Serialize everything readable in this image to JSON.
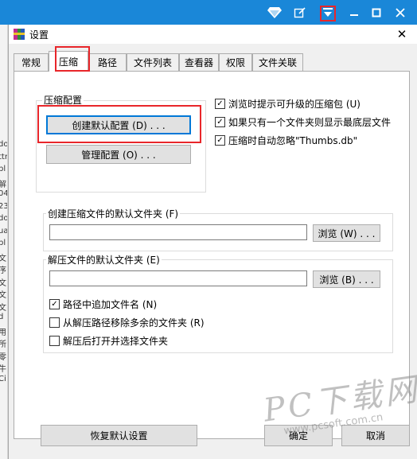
{
  "dialog": {
    "title": "设置",
    "close_glyph": "✕"
  },
  "tabs": [
    {
      "label": "常规",
      "active": false
    },
    {
      "label": "压缩",
      "active": true
    },
    {
      "label": "路径",
      "active": false
    },
    {
      "label": "文件列表",
      "active": false
    },
    {
      "label": "查看器",
      "active": false
    },
    {
      "label": "权限",
      "active": false
    },
    {
      "label": "文件关联",
      "active": false
    }
  ],
  "compress_config": {
    "title": "压缩配置",
    "create_default_label": "创建默认配置 (D) . . .",
    "manage_label": "管理配置 (O) . . ."
  },
  "options": [
    {
      "label": "浏览时提示可升级的压缩包 (U)",
      "checked": true
    },
    {
      "label": "如果只有一个文件夹则显示最底层文件",
      "checked": true
    },
    {
      "label": "压缩时自动忽略\"Thumbs.db\"",
      "checked": true
    }
  ],
  "default_folder": {
    "title": "创建压缩文件的默认文件夹 (F)",
    "value": "",
    "browse_label": "浏览 (W) . . ."
  },
  "extract_folder": {
    "title": "解压文件的默认文件夹 (E)",
    "value": "",
    "browse_label": "浏览 (B) . . .",
    "options": [
      {
        "label": "路径中追加文件名 (N)",
        "checked": true
      },
      {
        "label": "从解压路径移除多余的文件夹 (R)",
        "checked": false
      },
      {
        "label": "解压后打开并选择文件夹",
        "checked": false
      }
    ]
  },
  "footer": {
    "restore_label": "恢复默认设置",
    "ok_label": "确定",
    "cancel_label": "取消"
  },
  "titlebar_icons": [
    "gem-icon",
    "edit-icon",
    "menu-dropdown-icon",
    "minimize-icon",
    "maximize-icon",
    "close-icon"
  ],
  "background_text": [
    "do",
    "ttr",
    "pl",
    "解",
    "04",
    "23",
    "do",
    "ua",
    "pl",
    "文",
    "序",
    "文",
    "文",
    "文",
    "d",
    "用",
    "所",
    "零",
    "牛",
    "Ci"
  ],
  "watermark": {
    "big": "PC下载网",
    "small": "www.pcsoft.com.cn"
  },
  "colors": {
    "titlebar_blue": "#1a87d8",
    "highlight_red": "#e8262a",
    "focus_blue": "#0078d7"
  }
}
